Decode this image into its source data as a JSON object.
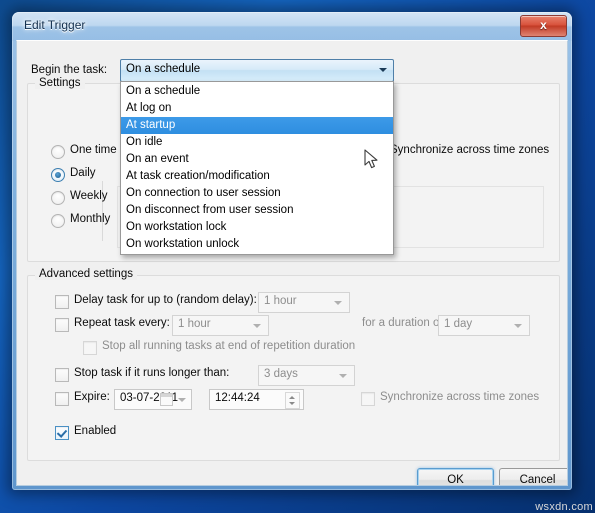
{
  "window": {
    "title": "Edit Trigger",
    "close_label": "x"
  },
  "begin": {
    "label": "Begin the task:",
    "selected": "On a schedule",
    "options": [
      "On a schedule",
      "At log on",
      "At startup",
      "On idle",
      "On an event",
      "At task creation/modification",
      "On connection to user session",
      "On disconnect from user session",
      "On workstation lock",
      "On workstation unlock"
    ],
    "highlighted_option": "At startup",
    "highlight_color": "#2e8ee0"
  },
  "settings": {
    "legend": "Settings",
    "radios": [
      {
        "label": "One time",
        "selected": false
      },
      {
        "label": "Daily",
        "selected": true
      },
      {
        "label": "Weekly",
        "selected": false
      },
      {
        "label": "Monthly",
        "selected": false
      }
    ],
    "sync_label": "Synchronize across time zones"
  },
  "advanced": {
    "legend": "Advanced settings",
    "delay": {
      "label": "Delay task for up to (random delay):",
      "checked": false,
      "value": "1 hour"
    },
    "repeat": {
      "label": "Repeat task every:",
      "checked": false,
      "value": "1 hour",
      "duration_label": "for a duration of:",
      "duration_value": "1 day"
    },
    "stop_all": {
      "label": "Stop all running tasks at end of repetition duration",
      "checked": false
    },
    "stop_task": {
      "label": "Stop task if it runs longer than:",
      "checked": false,
      "value": "3 days"
    },
    "expire": {
      "label": "Expire:",
      "checked": false,
      "date": "03-07-2011",
      "time": "12:44:24",
      "sync_label": "Synchronize across time zones",
      "sync_checked": false
    },
    "enabled": {
      "label": "Enabled",
      "checked": true
    }
  },
  "footer": {
    "ok_label": "OK",
    "cancel_label": "Cancel"
  },
  "watermark": "wsxdn.com"
}
